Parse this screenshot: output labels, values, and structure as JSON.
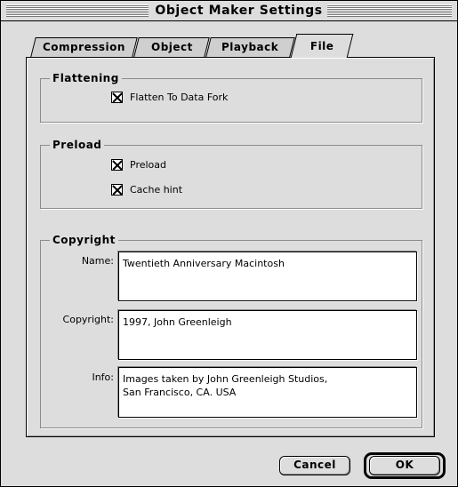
{
  "window": {
    "title": "Object Maker Settings"
  },
  "tabs": [
    {
      "label": "Compression",
      "active": false
    },
    {
      "label": "Object",
      "active": false
    },
    {
      "label": "Playback",
      "active": false
    },
    {
      "label": "File",
      "active": true
    }
  ],
  "flattening": {
    "title": "Flattening",
    "options": [
      {
        "label": "Flatten To Data Fork",
        "checked": true
      }
    ]
  },
  "preload": {
    "title": "Preload",
    "options": [
      {
        "label": "Preload",
        "checked": true
      },
      {
        "label": "Cache hint",
        "checked": true
      }
    ]
  },
  "copyright": {
    "title": "Copyright",
    "fields": [
      {
        "label": "Name:",
        "value": "Twentieth Anniversary Macintosh"
      },
      {
        "label": "Copyright:",
        "value": "1997, John Greenleigh"
      },
      {
        "label": "Info:",
        "value": "Images taken by John Greenleigh Studios,\nSan Francisco, CA. USA"
      }
    ]
  },
  "buttons": {
    "cancel": "Cancel",
    "ok": "OK"
  },
  "colors": {
    "window_background": "#dddddd",
    "field_background": "#ffffff",
    "border": "#000000"
  }
}
